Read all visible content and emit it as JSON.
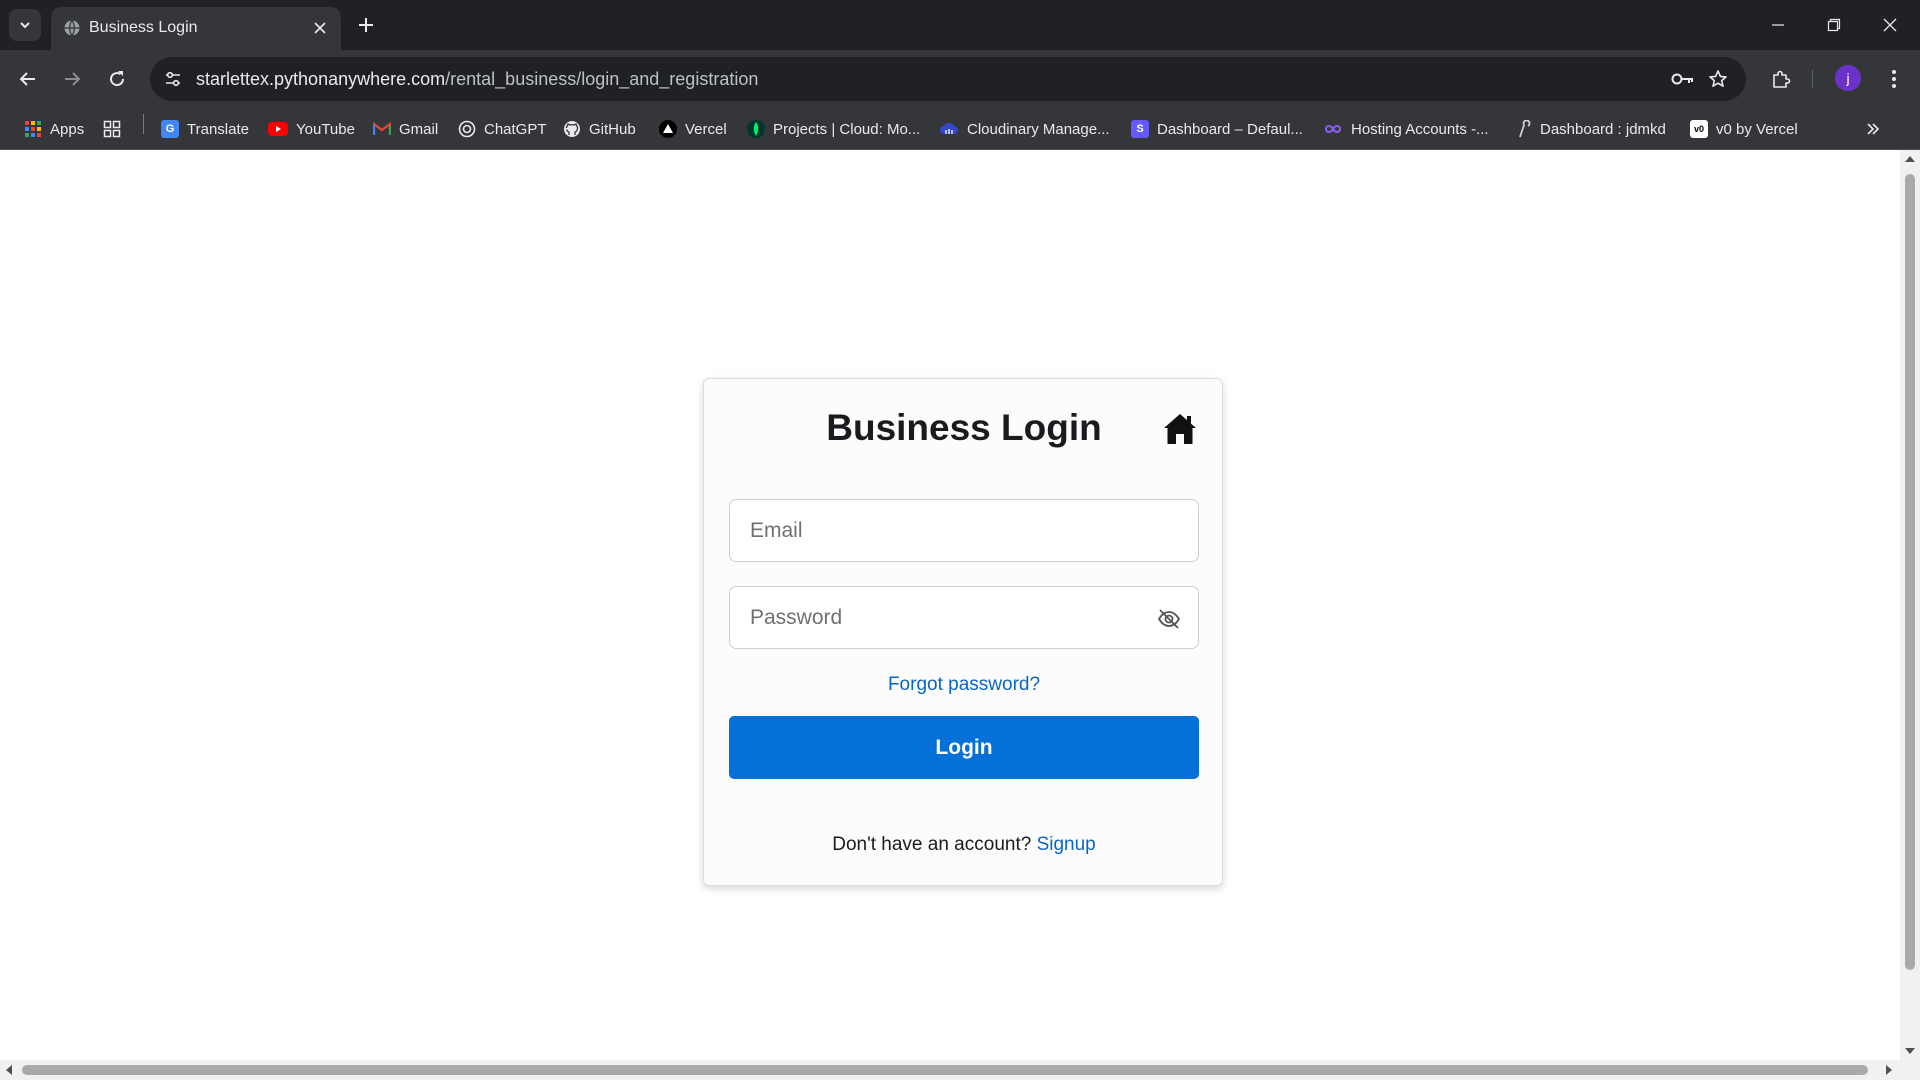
{
  "browser": {
    "tab": {
      "title": "Business Login",
      "favicon": "globe-icon"
    },
    "url": {
      "host": "starlettex.pythonanywhere.com",
      "path": "/rental_business/login_and_registration"
    },
    "profile_initial": "j",
    "bookmarks": [
      {
        "label": "Apps",
        "icon": "apps-grid-icon",
        "color": "#4285f4"
      },
      {
        "label": "Translate",
        "icon": "translate-icon",
        "color": "#4285f4"
      },
      {
        "label": "YouTube",
        "icon": "youtube-icon",
        "color": "#ff0000"
      },
      {
        "label": "Gmail",
        "icon": "gmail-icon",
        "color": "#ea4335"
      },
      {
        "label": "ChatGPT",
        "icon": "chatgpt-icon",
        "color": "#e8eaed"
      },
      {
        "label": "GitHub",
        "icon": "github-icon",
        "color": "#e8eaed"
      },
      {
        "label": "Vercel",
        "icon": "vercel-icon",
        "color": "#ffffff"
      },
      {
        "label": "Projects | Cloud: Mo...",
        "icon": "mongodb-leaf-icon",
        "color": "#00ed64"
      },
      {
        "label": "Cloudinary Manage...",
        "icon": "cloudinary-icon",
        "color": "#3448c5"
      },
      {
        "label": "Dashboard – Defaul...",
        "icon": "stripe-icon",
        "color": "#635bff"
      },
      {
        "label": "Hosting Accounts -...",
        "icon": "infinity-icon",
        "color": "#8b5cf6"
      },
      {
        "label": "Dashboard : jdmkd",
        "icon": "pythonanywhere-icon",
        "color": "#cfcfcf"
      },
      {
        "label": "v0 by Vercel",
        "icon": "v0-icon",
        "color": "#ffffff"
      }
    ]
  },
  "login": {
    "title": "Business Login",
    "email_placeholder": "Email",
    "password_placeholder": "Password",
    "forgot_label": "Forgot password?",
    "login_label": "Login",
    "signup_prompt": "Don't have an account?",
    "signup_label": "Signup"
  },
  "colors": {
    "primary": "#0570d8",
    "link": "#0a66c2",
    "browser_dark": "#202124",
    "browser_toolbar": "#35363a"
  }
}
